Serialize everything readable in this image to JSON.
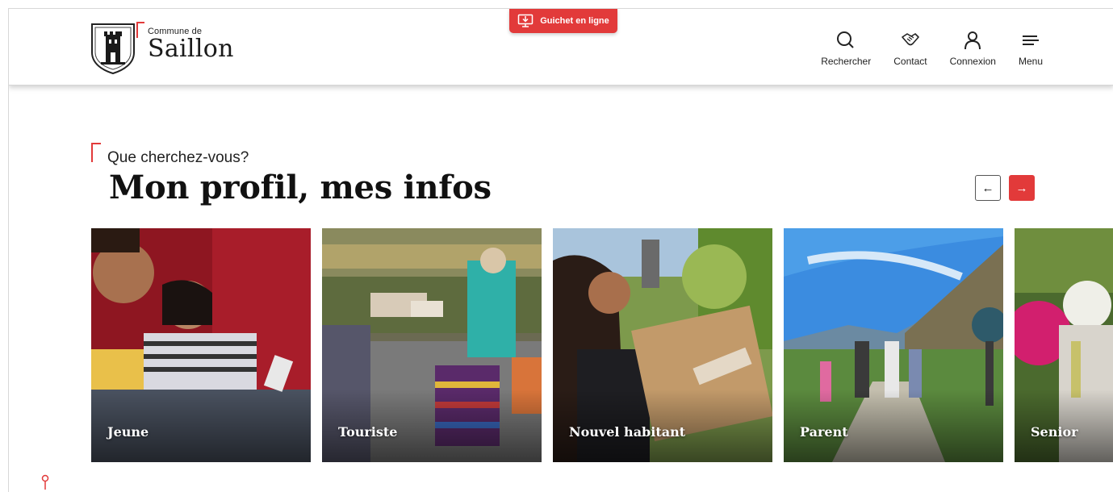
{
  "header": {
    "logo_small": "Commune de",
    "logo_big": "Saillon",
    "guichet_label": "Guichet en ligne",
    "nav": [
      {
        "label": "Rechercher",
        "icon": "search-icon"
      },
      {
        "label": "Contact",
        "icon": "handshake-icon"
      },
      {
        "label": "Connexion",
        "icon": "user-icon"
      },
      {
        "label": "Menu",
        "icon": "menu-icon"
      }
    ]
  },
  "section": {
    "eyebrow": "Que cherchez-vous?",
    "title": "Mon profil, mes infos",
    "prev_label": "←",
    "next_label": "→"
  },
  "cards": [
    {
      "label": "Jeune"
    },
    {
      "label": "Touriste"
    },
    {
      "label": "Nouvel habitant"
    },
    {
      "label": "Parent"
    },
    {
      "label": "Senior"
    }
  ],
  "colors": {
    "accent": "#e23a3a",
    "text": "#111111"
  }
}
